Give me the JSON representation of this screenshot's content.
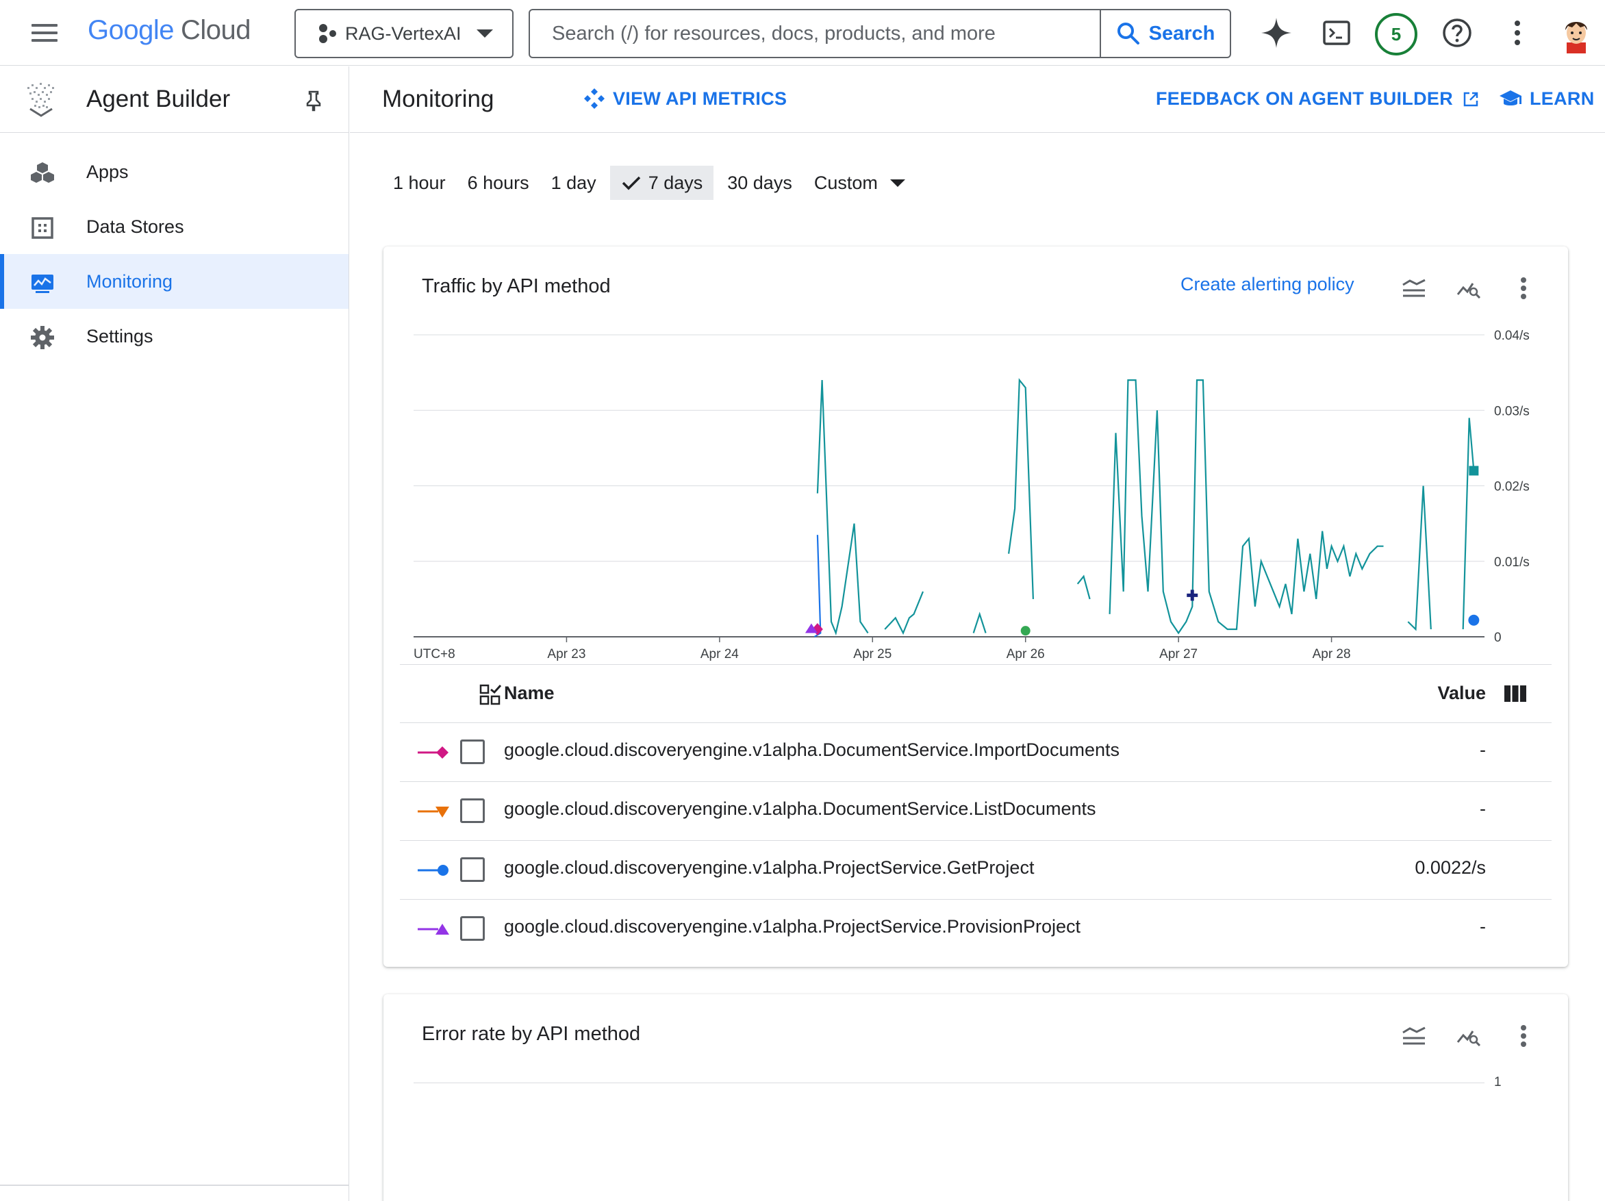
{
  "header": {
    "logo_google": "Google",
    "logo_cloud": "Cloud",
    "project_name": "RAG-VertexAI",
    "search_placeholder": "Search (/) for resources, docs, products, and more",
    "search_button": "Search",
    "notification_count": "5"
  },
  "sidebar": {
    "title": "Agent Builder",
    "items": [
      {
        "label": "Apps",
        "icon": "apps-icon"
      },
      {
        "label": "Data Stores",
        "icon": "data-stores-icon"
      },
      {
        "label": "Monitoring",
        "icon": "monitoring-icon",
        "active": true
      },
      {
        "label": "Settings",
        "icon": "gear-icon"
      }
    ]
  },
  "main": {
    "title": "Monitoring",
    "view_api_metrics": "VIEW API METRICS",
    "feedback": "FEEDBACK ON AGENT BUILDER",
    "learn": "LEARN"
  },
  "time_range": {
    "options": [
      "1 hour",
      "6 hours",
      "1 day",
      "7 days",
      "30 days",
      "Custom"
    ],
    "selected": "7 days"
  },
  "traffic_card": {
    "title": "Traffic by API method",
    "alert_link": "Create alerting policy",
    "legend_header_name": "Name",
    "legend_header_value": "Value",
    "legend": [
      {
        "name": "google.cloud.discoveryengine.v1alpha.DocumentService.ImportDocuments",
        "value": "-",
        "color": "#d01884",
        "marker": "diamond"
      },
      {
        "name": "google.cloud.discoveryengine.v1alpha.DocumentService.ListDocuments",
        "value": "-",
        "color": "#e8710a",
        "marker": "triangle-down"
      },
      {
        "name": "google.cloud.discoveryengine.v1alpha.ProjectService.GetProject",
        "value": "0.0022/s",
        "color": "#1a73e8",
        "marker": "circle"
      },
      {
        "name": "google.cloud.discoveryengine.v1alpha.ProjectService.ProvisionProject",
        "value": "-",
        "color": "#9334e6",
        "marker": "triangle-up"
      }
    ]
  },
  "error_card": {
    "title": "Error rate by API method",
    "y_top_label": "1"
  },
  "chart_data": {
    "type": "line",
    "title": "Traffic by API method",
    "timezone_label": "UTC+8",
    "x_tick_labels": [
      "Apr 23",
      "Apr 24",
      "Apr 25",
      "Apr 26",
      "Apr 27",
      "Apr 28"
    ],
    "y_tick_labels": [
      "0",
      "0.01/s",
      "0.02/s",
      "0.03/s",
      "0.04/s"
    ],
    "ylim": [
      0,
      0.04
    ],
    "x_range_days": [
      22.0,
      29.0
    ],
    "grid": true,
    "series_color": "#12939a",
    "segments": [
      [
        [
          24.64,
          0.019
        ],
        [
          24.67,
          0.034
        ],
        [
          24.7,
          0.018
        ],
        [
          24.73,
          0.002
        ],
        [
          24.76,
          0.0005
        ],
        [
          24.8,
          0.004
        ],
        [
          24.88,
          0.015
        ],
        [
          24.92,
          0.002
        ],
        [
          24.97,
          0.0005
        ]
      ],
      [
        [
          25.08,
          0.001
        ],
        [
          25.15,
          0.0025
        ],
        [
          25.2,
          0.0005
        ],
        [
          25.24,
          0.0025
        ],
        [
          25.27,
          0.003
        ],
        [
          25.33,
          0.006
        ]
      ],
      [
        [
          25.66,
          0.0005
        ],
        [
          25.7,
          0.003
        ],
        [
          25.74,
          0.0005
        ]
      ],
      [
        [
          25.89,
          0.011
        ],
        [
          25.93,
          0.017
        ],
        [
          25.96,
          0.034
        ],
        [
          26.0,
          0.033
        ],
        [
          26.05,
          0.005
        ]
      ],
      [
        [
          26.34,
          0.007
        ],
        [
          26.38,
          0.008
        ],
        [
          26.42,
          0.005
        ]
      ],
      [
        [
          26.55,
          0.003
        ],
        [
          26.59,
          0.027
        ],
        [
          26.64,
          0.006
        ],
        [
          26.67,
          0.034
        ],
        [
          26.72,
          0.034
        ],
        [
          26.76,
          0.016
        ],
        [
          26.8,
          0.006
        ],
        [
          26.86,
          0.03
        ],
        [
          26.9,
          0.006
        ],
        [
          26.95,
          0.002
        ],
        [
          27.0,
          0.0005
        ],
        [
          27.05,
          0.002
        ],
        [
          27.09,
          0.004
        ],
        [
          27.12,
          0.034
        ],
        [
          27.16,
          0.034
        ],
        [
          27.2,
          0.006
        ],
        [
          27.26,
          0.002
        ],
        [
          27.32,
          0.001
        ],
        [
          27.38,
          0.001
        ],
        [
          27.42,
          0.012
        ],
        [
          27.46,
          0.013
        ],
        [
          27.5,
          0.004
        ],
        [
          27.54,
          0.01
        ],
        [
          27.58,
          0.008
        ],
        [
          27.62,
          0.006
        ],
        [
          27.66,
          0.004
        ],
        [
          27.7,
          0.007
        ],
        [
          27.74,
          0.003
        ],
        [
          27.78,
          0.013
        ],
        [
          27.82,
          0.006
        ],
        [
          27.86,
          0.011
        ],
        [
          27.9,
          0.005
        ],
        [
          27.94,
          0.014
        ],
        [
          27.97,
          0.009
        ],
        [
          28.0,
          0.012
        ],
        [
          28.04,
          0.01
        ],
        [
          28.08,
          0.012
        ],
        [
          28.12,
          0.008
        ],
        [
          28.16,
          0.011
        ],
        [
          28.2,
          0.009
        ],
        [
          28.25,
          0.011
        ],
        [
          28.3,
          0.012
        ],
        [
          28.34,
          0.012
        ]
      ],
      [
        [
          28.5,
          0.002
        ],
        [
          28.55,
          0.001
        ],
        [
          28.6,
          0.02
        ],
        [
          28.65,
          0.001
        ]
      ],
      [
        [
          28.86,
          0.001
        ],
        [
          28.9,
          0.029
        ],
        [
          28.93,
          0.022
        ]
      ]
    ],
    "minor_series": {
      "ImportDocuments": [
        [
          24.64,
          0.001
        ]
      ],
      "ListDocuments": [
        [
          24.62,
          0.0005
        ]
      ],
      "GetProject": [
        [
          24.64,
          0.0135
        ],
        [
          24.66,
          0.0005
        ],
        [
          28.93,
          0.0022
        ]
      ],
      "ProvisionProject": [
        [
          24.6,
          0.0005
        ]
      ]
    }
  }
}
